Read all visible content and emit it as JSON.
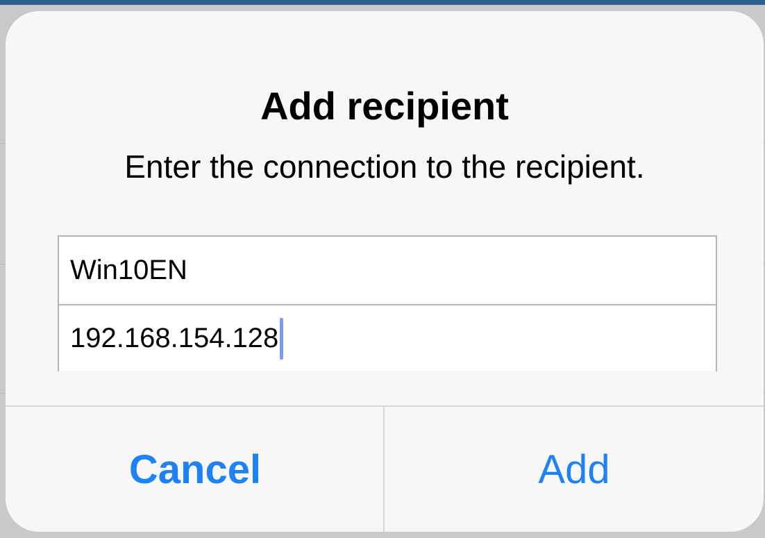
{
  "dialog": {
    "title": "Add recipient",
    "message": "Enter the connection to the recipient.",
    "fields": {
      "name_value": "Win10EN",
      "address_value": "192.168.154.128"
    },
    "buttons": {
      "cancel_label": "Cancel",
      "add_label": "Add"
    }
  },
  "colors": {
    "accent": "#1e82f5",
    "caret": "#7d9cf0",
    "window_top_bar": "#2f5f8e"
  }
}
